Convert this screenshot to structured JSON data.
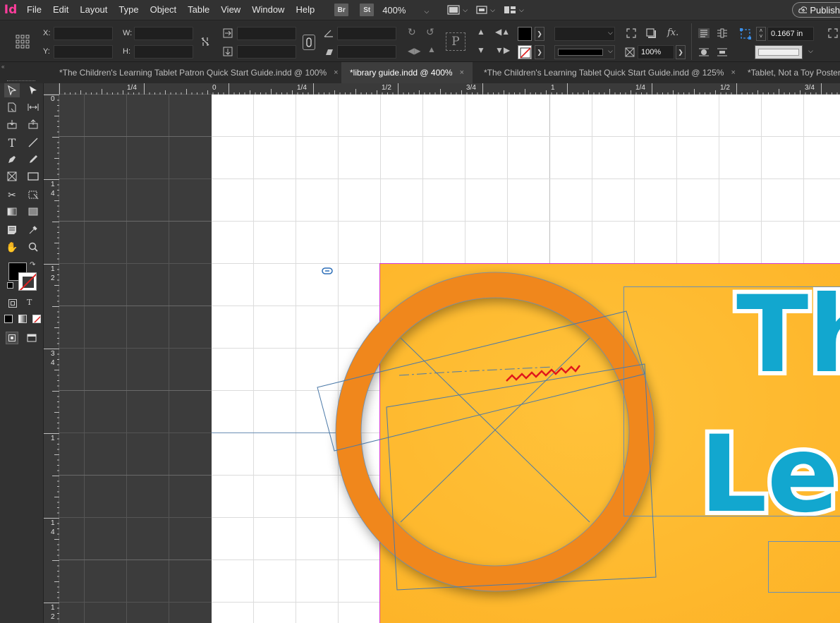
{
  "app": {
    "logo": "Id"
  },
  "menu": [
    "File",
    "Edit",
    "Layout",
    "Type",
    "Object",
    "Table",
    "View",
    "Window",
    "Help"
  ],
  "menu_extras": {
    "bridge": "Br",
    "stock": "St",
    "zoom": "400%",
    "publish": "Publish"
  },
  "control": {
    "x_label": "X:",
    "y_label": "Y:",
    "w_label": "W:",
    "h_label": "H:",
    "scale_percent": "100%",
    "stroke_weight": "0.1667 in"
  },
  "tabs": [
    {
      "title": "*The Children's Learning Tablet Patron Quick Start Guide.indd @ 100%",
      "close": "×",
      "active": false
    },
    {
      "title": "*library guide.indd @ 400%",
      "close": "×",
      "active": true
    },
    {
      "title": "*The Children's Learning Tablet Quick Start Guide.indd @ 125%",
      "close": "×",
      "active": false
    },
    {
      "title": "*Tablet, Not a Toy Poster",
      "close": "",
      "active": false
    }
  ],
  "ruler_top": [
    "1/4",
    "0",
    "1/4",
    "1/2",
    "3/4",
    "1",
    "1/4",
    "1/2",
    "3/4"
  ],
  "ruler_left": [
    {
      "a": "0",
      "b": ""
    },
    {
      "a": "1",
      "b": "4"
    },
    {
      "a": "1",
      "b": "2"
    },
    {
      "a": "3",
      "b": "4"
    },
    {
      "a": "1",
      "b": ""
    },
    {
      "a": "1",
      "b": "4"
    },
    {
      "a": "1",
      "b": "2"
    }
  ],
  "artwork": {
    "headline_line1": "Th",
    "headline_line2": "Le"
  },
  "colors": {
    "poster_orange": "#fdb327",
    "ring_orange": "#f0871f",
    "headline_blue": "#12a7cf",
    "accent_magenta": "#ff3d9c"
  },
  "icons": {
    "selection": "selection-tool-icon",
    "direct": "direct-selection-tool-icon",
    "type": "type-tool-icon",
    "pen": "pen-tool-icon",
    "frame": "rectangle-frame-tool-icon",
    "scissors": "scissors-tool-icon",
    "hand": "hand-tool-icon",
    "zoom": "zoom-tool-icon"
  }
}
